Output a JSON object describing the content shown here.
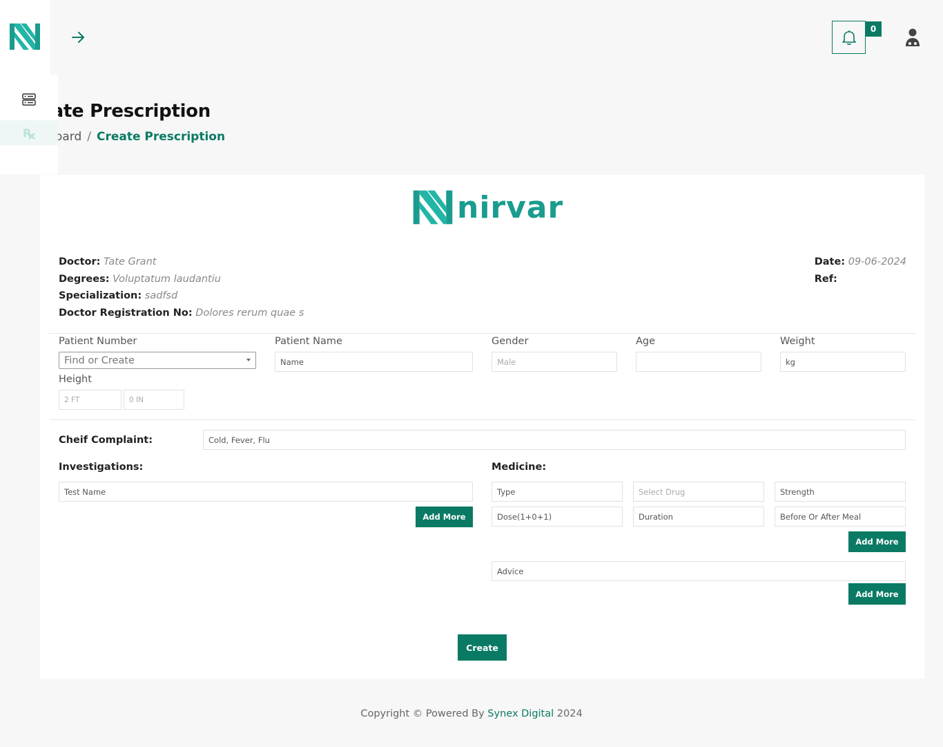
{
  "nav": {
    "logo_alt": "N"
  },
  "header": {
    "notification_count": "0"
  },
  "page": {
    "title": "Create Prescription",
    "breadcrumb": [
      "Dashboard",
      "Create Prescription"
    ],
    "breadcrumb_separator": "/"
  },
  "brand": {
    "name": "nirvar"
  },
  "doctor": {
    "name_label": "Doctor:",
    "name": "Tate Grant",
    "degrees_label": "Degrees:",
    "degrees": "Voluptatum laudantiu",
    "specialization_label": "Specialization:",
    "specialization": "sadfsd",
    "registration_label": "Doctor Registration No:",
    "registration": "Dolores rerum quae s"
  },
  "meta": {
    "date_label": "Date:",
    "date": "09-06-2024",
    "ref_label": "Ref:"
  },
  "patient": {
    "number_label": "Patient Number",
    "number_placeholder": "Find or Create",
    "name_label": "Patient Name",
    "name_placeholder": "Name",
    "gender_label": "Gender",
    "gender_placeholder": "Male",
    "age_label": "Age",
    "weight_label": "Weight",
    "weight_placeholder": "kg",
    "height_label": "Height",
    "height_ft_placeholder": "2 FT",
    "height_in_placeholder": "0 IN"
  },
  "complaint": {
    "label": "Cheif Complaint:",
    "value": "Cold, Fever, Flu"
  },
  "investigations": {
    "label": "Investigations:",
    "test_placeholder": "Test Name",
    "add_more": "Add More"
  },
  "medicine": {
    "label": "Medicine:",
    "type_placeholder": "Type",
    "drug_placeholder": "Select Drug",
    "strength_placeholder": "Strength",
    "dose_placeholder": "Dose(1+0+1)",
    "duration_placeholder": "Duration",
    "meal_placeholder": "Before Or After Meal",
    "add_more": "Add More",
    "advice_placeholder": "Advice",
    "advice_add_more": "Add More"
  },
  "actions": {
    "create": "Create"
  },
  "footer": {
    "prefix": "Copyright © Powered By",
    "company": "Synex Digital",
    "year": "2024"
  },
  "colors": {
    "accent": "#0a7a64",
    "brand_teal": "#1a9c8f"
  }
}
